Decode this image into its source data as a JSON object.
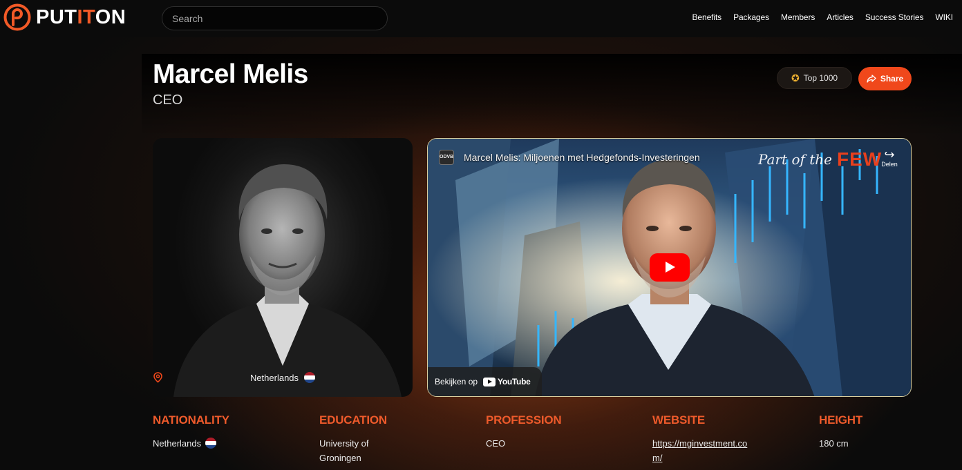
{
  "brand": {
    "logo_text_a": "PUT",
    "logo_text_b": "IT",
    "logo_text_c": "ON",
    "accent_color": "#f25a27"
  },
  "search": {
    "placeholder": "Search"
  },
  "nav": [
    "Benefits",
    "Packages",
    "Members",
    "Articles",
    "Success Stories",
    "WIKI"
  ],
  "profile": {
    "name": "Marcel Melis",
    "role": "CEO",
    "top_badge": "Top 1000",
    "share_label": "Share",
    "location": "Netherlands",
    "flag": "netherlands-flag"
  },
  "video": {
    "channel_icon": "ODVB",
    "title": "Marcel Melis: Miljoenen met Hedgefonds-Investeringen",
    "overlay_script": "Part of the",
    "overlay_brand": "FEW",
    "share_label": "Delen",
    "watch_label": "Bekijken op",
    "platform": "YouTube",
    "play_color": "#ff0000"
  },
  "facts": [
    {
      "label": "NATIONALITY",
      "value": "Netherlands"
    },
    {
      "label": "EDUCATION",
      "value": "University of Groningen"
    },
    {
      "label": "PROFESSION",
      "value": "CEO"
    },
    {
      "label": "WEBSITE",
      "value": "https://mginvestment.com/"
    },
    {
      "label": "HEIGHT",
      "value": "180 cm"
    }
  ]
}
